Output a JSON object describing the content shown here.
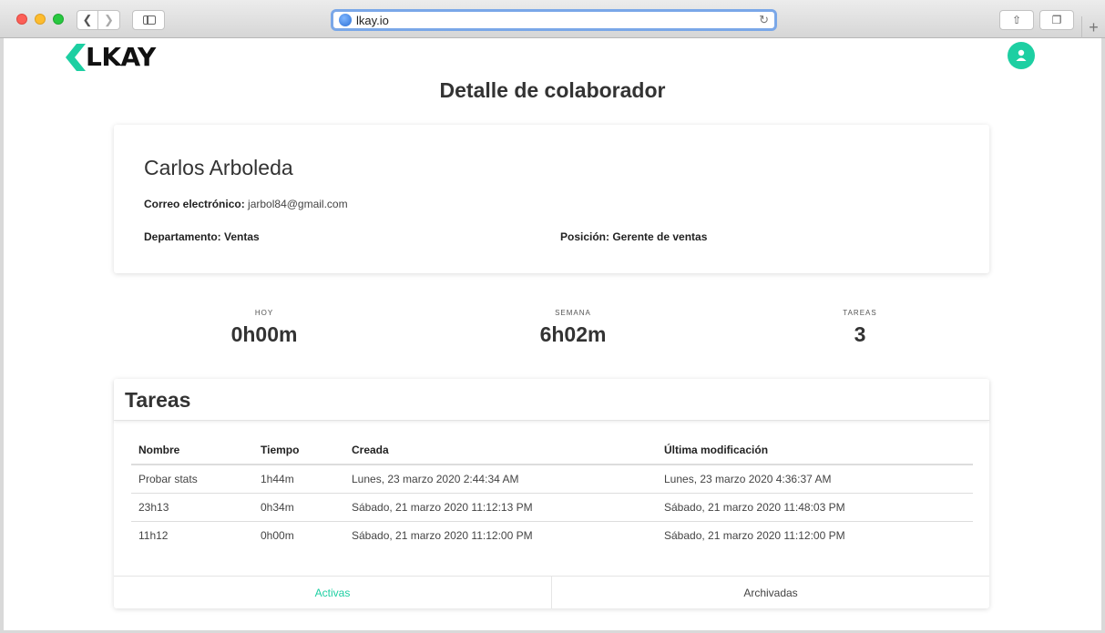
{
  "browser": {
    "url": "lkay.io"
  },
  "brand": {
    "logo_text": "LKAY",
    "accent": "#1dcfa2"
  },
  "page": {
    "title": "Detalle de colaborador"
  },
  "employee": {
    "name": "Carlos Arboleda",
    "email_label": "Correo electrónico:",
    "email": "jarbol84@gmail.com",
    "department": "Departamento: Ventas",
    "position": "Posición: Gerente de ventas"
  },
  "stats": {
    "hoy_label": "HOY",
    "hoy_value": "0h00m",
    "semana_label": "SEMANA",
    "semana_value": "6h02m",
    "tareas_label": "TAREAS",
    "tareas_value": "3"
  },
  "tasks": {
    "title": "Tareas",
    "columns": [
      "Nombre",
      "Tiempo",
      "Creada",
      "Última modificación"
    ],
    "rows": [
      [
        "Probar stats",
        "1h44m",
        "Lunes, 23 marzo 2020 2:44:34 AM",
        "Lunes, 23 marzo 2020 4:36:37 AM"
      ],
      [
        "23h13",
        "0h34m",
        "Sábado, 21 marzo 2020 11:12:13 PM",
        "Sábado, 21 marzo 2020 11:48:03 PM"
      ],
      [
        "11h12",
        "0h00m",
        "Sábado, 21 marzo 2020 11:12:00 PM",
        "Sábado, 21 marzo 2020 11:12:00 PM"
      ]
    ],
    "tab_active": "Activas",
    "tab_archived": "Archivadas"
  }
}
